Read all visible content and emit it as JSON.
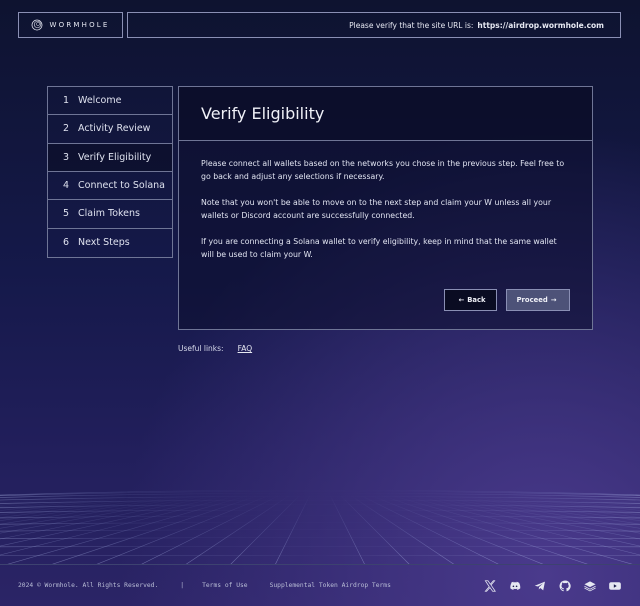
{
  "header": {
    "logo_text": "WORMHOLE",
    "url_notice": "Please verify that the site URL is:",
    "url": "https://airdrop.wormhole.com"
  },
  "steps": [
    {
      "num": "1",
      "label": "Welcome"
    },
    {
      "num": "2",
      "label": "Activity Review"
    },
    {
      "num": "3",
      "label": "Verify Eligibility"
    },
    {
      "num": "4",
      "label": "Connect to Solana"
    },
    {
      "num": "5",
      "label": "Claim Tokens"
    },
    {
      "num": "6",
      "label": "Next Steps"
    }
  ],
  "panel": {
    "title": "Verify Eligibility",
    "paragraphs": [
      "Please connect all wallets based on the networks you chose in the previous step. Feel free to go back and adjust any selections if necessary.",
      "Note that you won't be able to move on to the next step and claim your W unless all your wallets or Discord account are successfully connected.",
      "If you are connecting a Solana wallet to verify eligibility, keep in mind that the same wallet will be used to claim your W."
    ],
    "back_label": "Back",
    "proceed_label": "Proceed"
  },
  "useful_links": {
    "label": "Useful links:",
    "faq": "FAQ"
  },
  "footer": {
    "copyright": "2024 © Wormhole. All Rights Reserved.",
    "separator": "|",
    "terms": "Terms of Use",
    "supplemental": "Supplemental Token Airdrop Terms"
  },
  "icons": {
    "x": "x-twitter-icon",
    "discord": "discord-icon",
    "telegram": "telegram-icon",
    "github": "github-icon",
    "docs": "docs-icon",
    "youtube": "youtube-icon"
  }
}
